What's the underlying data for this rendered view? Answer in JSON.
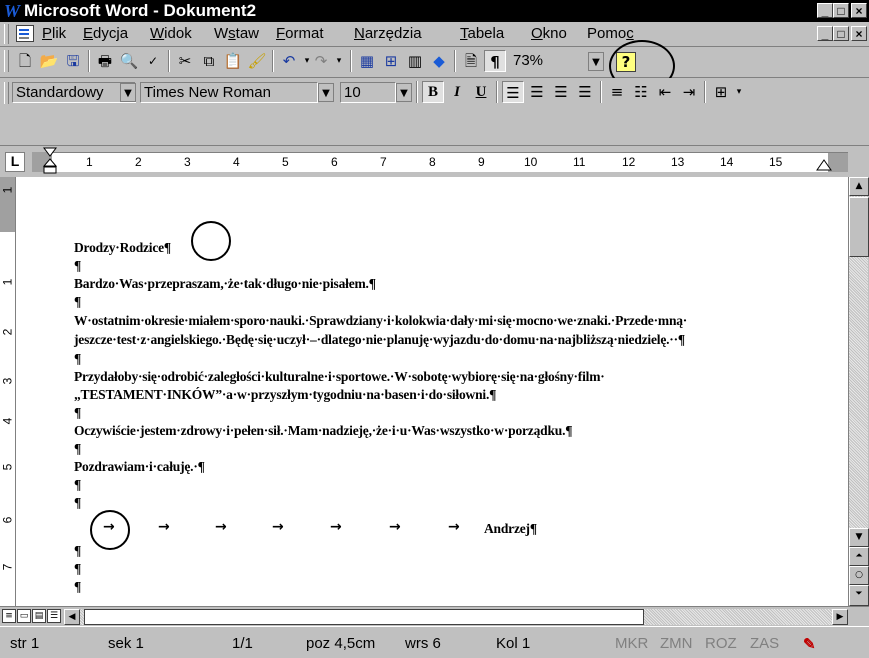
{
  "app": {
    "title": "Microsoft Word - Dokument2",
    "logo_letter": "W",
    "window_buttons": [
      "_",
      "×"
    ]
  },
  "menu": {
    "items": [
      {
        "u": "P",
        "rest": "lik"
      },
      {
        "u": "E",
        "rest": "dycja"
      },
      {
        "u": "W",
        "rest": "idok"
      },
      {
        "pre": "W",
        "u": "s",
        "rest": "taw"
      },
      {
        "u": "F",
        "rest": "ormat"
      },
      {
        "u": "N",
        "rest": "arzędzia"
      },
      {
        "u": "T",
        "rest": "abela"
      },
      {
        "u": "O",
        "rest": "kno"
      },
      {
        "pre": "Pomo",
        "u": "c",
        "rest": ""
      }
    ]
  },
  "standard_toolbar": {
    "zoom": "73%",
    "pilcrow": "¶",
    "help": "?"
  },
  "format_toolbar": {
    "style": "Standardowy",
    "font": "Times New Roman",
    "size": "10",
    "bold": "B",
    "italic": "I",
    "underline": "U"
  },
  "ruler": {
    "tab_selector": "L",
    "ticks": [
      "1",
      "2",
      "3",
      "4",
      "5",
      "6",
      "7",
      "8",
      "9",
      "10",
      "11",
      "12",
      "13",
      "14",
      "15"
    ],
    "vticks": [
      "1",
      "1",
      "2",
      "3",
      "4",
      "5",
      "6",
      "7"
    ]
  },
  "document": {
    "lines": [
      "Drodzy·Rodzice¶",
      "¶",
      "Bardzo·Was·przepraszam,·że·tak·długo·nie·pisałem.¶",
      "¶",
      "W·ostatnim·okresie·miałem·sporo·nauki.·Sprawdziany·i·kolokwia·dały·mi·się·mocno·we·znaki.·Przede·mną·",
      "jeszcze·test·z·angielskiego.·Będę·się·uczył·–·dlatego·nie·planuję·wyjazdu·do·domu·na·najbliższą·niedzielę.··¶",
      "¶",
      "Przydałoby·się·odrobić·zaległości·kulturalne·i·sportowe.·W·sobotę·wybiorę·się·na·głośny·film·",
      "„TESTAMENT·INKÓW”·a·w·przyszłym·tygodniu·na·basen·i·do·siłowni.¶",
      "¶",
      "Oczywiście·jestem·zdrowy·i·pełen·sił.·Mam·nadzieję,·że·i·u·Was·wszystko·w·porządku.¶",
      "¶",
      "Pozdrawiam·i·całuję.·¶",
      "¶",
      "¶"
    ],
    "signature": "Andrzej¶",
    "tab_arrow": "→",
    "trailing": [
      "¶",
      "¶",
      "¶"
    ]
  },
  "status": {
    "page": "str 1",
    "section": "sek 1",
    "pages": "1/1",
    "position": "poz 4,5cm",
    "line": "wrs 6",
    "column": "Kol 1",
    "mkr": "MKR",
    "zmn": "ZMN",
    "roz": "ROZ",
    "zas": "ZAS"
  }
}
